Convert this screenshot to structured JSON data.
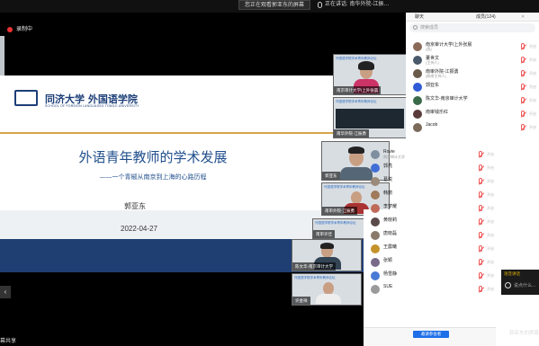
{
  "top_bar": {
    "share_banner": "您正在观看郭亚东的屏幕",
    "speaking": "正在讲话: 南华外院-江振…"
  },
  "recording": "录制中",
  "slide": {
    "logo_text": "同济大学 外国语学院",
    "logo_subtext": "SCHOOL OF FOREIGN LANGUAGES TONGJI UNIVERSITY",
    "title": "外语青年教师的学术发展",
    "subtitle": "——一个青椒从南京到上海的心路历程",
    "presenter": "郭亚东",
    "date": "2022-04-27"
  },
  "nav_left": "‹",
  "tiles": [
    {
      "label": "南京审计大学/上外张晨",
      "screen": "外国语学院学术青年教师论坛"
    },
    {
      "label": "南华外院-江振勇",
      "screen": "外国语学院学术青年教师论坛"
    },
    {
      "label": "郭亚东",
      "screen": ""
    },
    {
      "label": "南审外院-江振勇",
      "screen": "外国语学院学术青年教师论坛"
    },
    {
      "label": "南审许佳",
      "screen": "外国语学院学术青年教师论坛"
    },
    {
      "label": "陈文华-南京审计大学",
      "screen": "外国语学院学术青年教师论坛"
    },
    {
      "label": "许金祥",
      "screen": "外国语学院学术青年教师论坛"
    }
  ],
  "panel": {
    "tab_chat": "聊天",
    "tab_members": "成员(124)",
    "search_placeholder": "搜索成员",
    "participants": [
      {
        "name": "南京审计大学/上外张晨",
        "role": "(我)",
        "color": "#8b6a5a"
      },
      {
        "name": "董世文",
        "role": "(主持人)",
        "color": "#4a5a6b"
      },
      {
        "name": "南审外院-江振勇",
        "role": "(联席主持人)",
        "color": "#6a5a4a"
      },
      {
        "name": "郭亚东",
        "role": "",
        "color": "#2f5bd6"
      },
      {
        "name": "陈文华-南京审计大学",
        "role": "",
        "color": "#3a6a4a"
      },
      {
        "name": "南审钱乐红",
        "role": "",
        "color": "#5a3a3a"
      },
      {
        "name": "Jacob",
        "role": "",
        "color": "#7a6a5a"
      }
    ],
    "participants_lower": [
      {
        "name": "Rovie",
        "role": "南京审计大学",
        "color": "#7f8fa0"
      },
      {
        "name": "郭亮",
        "role": "",
        "color": "#3f6fd6"
      },
      {
        "name": "葛悦",
        "role": "",
        "color": "#9a8a7a"
      },
      {
        "name": "韩丽",
        "role": "",
        "color": "#a07a5a"
      },
      {
        "name": "李梦耀",
        "role": "",
        "color": "#c06a5a"
      },
      {
        "name": "黄晓莉",
        "role": "",
        "color": "#5a4a4a"
      },
      {
        "name": "唐晓磊",
        "role": "",
        "color": "#8a7a6a"
      },
      {
        "name": "王震曦",
        "role": "",
        "color": "#c4932a"
      },
      {
        "name": "张颖",
        "role": "",
        "color": "#7a6a8a"
      },
      {
        "name": "杨雪静",
        "role": "",
        "color": "#4a7ad6"
      },
      {
        "name": "SUE",
        "role": "",
        "color": "#9a9a9a"
      }
    ],
    "invite": "邀请参会者",
    "cam_label": "开启"
  },
  "chat": {
    "input": "说点什么...",
    "speaker_tag": "语音讲话",
    "speaker_name": "郭亚东的屏幕",
    "left_name": "幕共享"
  }
}
